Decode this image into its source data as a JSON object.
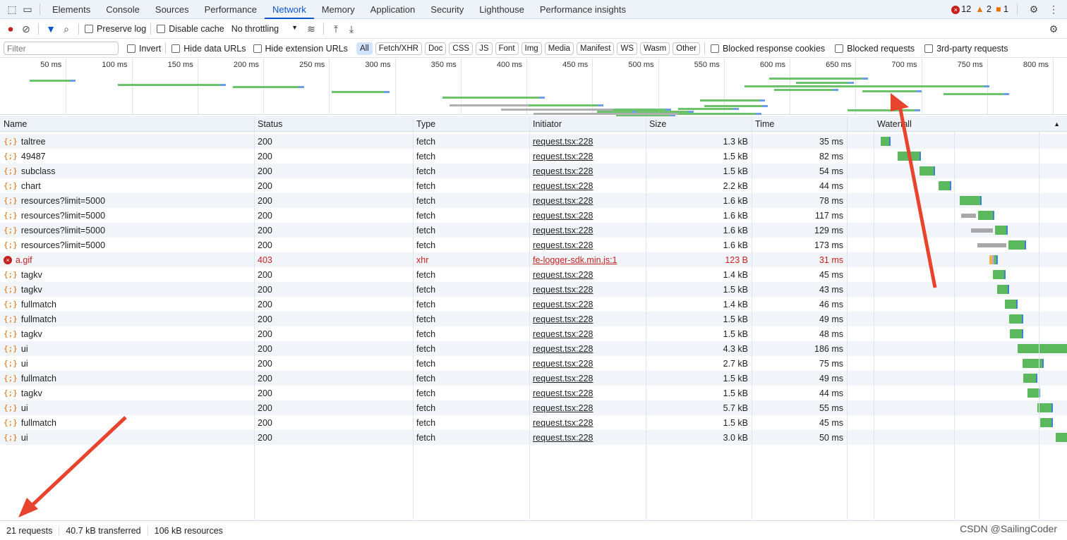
{
  "tabs": [
    "Elements",
    "Console",
    "Sources",
    "Performance",
    "Network",
    "Memory",
    "Application",
    "Security",
    "Lighthouse",
    "Performance insights"
  ],
  "active_tab": "Network",
  "badges": {
    "errors": "12",
    "warnings": "2",
    "issues": "1"
  },
  "toolbar": {
    "preserve_log": "Preserve log",
    "disable_cache": "Disable cache",
    "throttling": "No throttling"
  },
  "filterbar": {
    "placeholder": "Filter",
    "invert": "Invert",
    "hide_data": "Hide data URLs",
    "hide_ext": "Hide extension URLs",
    "types": [
      "All",
      "Fetch/XHR",
      "Doc",
      "CSS",
      "JS",
      "Font",
      "Img",
      "Media",
      "Manifest",
      "WS",
      "Wasm",
      "Other"
    ],
    "blocked_cookies": "Blocked response cookies",
    "blocked_requests": "Blocked requests",
    "third_party": "3rd-party requests"
  },
  "overview_ticks": [
    "50 ms",
    "100 ms",
    "150 ms",
    "200 ms",
    "250 ms",
    "300 ms",
    "350 ms",
    "400 ms",
    "450 ms",
    "500 ms",
    "550 ms",
    "600 ms",
    "650 ms",
    "700 ms",
    "750 ms",
    "800 ms"
  ],
  "columns": {
    "name": "Name",
    "status": "Status",
    "type": "Type",
    "initiator": "Initiator",
    "size": "Size",
    "time": "Time",
    "waterfall": "Waterfall"
  },
  "rows": [
    {
      "name": "taltree",
      "status": "200",
      "type": "fetch",
      "initiator": "request.tsx:228",
      "size": "1.3 kB",
      "time": "35 ms",
      "start": 20,
      "wait": 0,
      "dur": 35
    },
    {
      "name": "49487",
      "status": "200",
      "type": "fetch",
      "initiator": "request.tsx:228",
      "size": "1.5 kB",
      "time": "82 ms",
      "start": 80,
      "wait": 0,
      "dur": 82
    },
    {
      "name": "subclass",
      "status": "200",
      "type": "fetch",
      "initiator": "request.tsx:228",
      "size": "1.5 kB",
      "time": "54 ms",
      "start": 158,
      "wait": 0,
      "dur": 54
    },
    {
      "name": "chart",
      "status": "200",
      "type": "fetch",
      "initiator": "request.tsx:228",
      "size": "2.2 kB",
      "time": "44 ms",
      "start": 225,
      "wait": 0,
      "dur": 44
    },
    {
      "name": "resources?limit=5000",
      "status": "200",
      "type": "fetch",
      "initiator": "request.tsx:228",
      "size": "1.6 kB",
      "time": "78 ms",
      "start": 300,
      "wait": 0,
      "dur": 78
    },
    {
      "name": "resources?limit=5000",
      "status": "200",
      "type": "fetch",
      "initiator": "request.tsx:228",
      "size": "1.6 kB",
      "time": "117 ms",
      "start": 305,
      "wait": 60,
      "dur": 117
    },
    {
      "name": "resources?limit=5000",
      "status": "200",
      "type": "fetch",
      "initiator": "request.tsx:228",
      "size": "1.6 kB",
      "time": "129 ms",
      "start": 340,
      "wait": 85,
      "dur": 129
    },
    {
      "name": "resources?limit=5000",
      "status": "200",
      "type": "fetch",
      "initiator": "request.tsx:228",
      "size": "1.6 kB",
      "time": "173 ms",
      "start": 362,
      "wait": 110,
      "dur": 173
    },
    {
      "name": "a.gif",
      "status": "403",
      "type": "xhr",
      "initiator": "fe-logger-sdk.min.js:1",
      "size": "123 B",
      "time": "31 ms",
      "start": 405,
      "wait": 0,
      "dur": 31,
      "error": true
    },
    {
      "name": "tagkv",
      "status": "200",
      "type": "fetch",
      "initiator": "request.tsx:228",
      "size": "1.4 kB",
      "time": "45 ms",
      "start": 418,
      "wait": 0,
      "dur": 45
    },
    {
      "name": "tagkv",
      "status": "200",
      "type": "fetch",
      "initiator": "request.tsx:228",
      "size": "1.5 kB",
      "time": "43 ms",
      "start": 432,
      "wait": 0,
      "dur": 43
    },
    {
      "name": "fullmatch",
      "status": "200",
      "type": "fetch",
      "initiator": "request.tsx:228",
      "size": "1.4 kB",
      "time": "46 ms",
      "start": 460,
      "wait": 0,
      "dur": 46
    },
    {
      "name": "fullmatch",
      "status": "200",
      "type": "fetch",
      "initiator": "request.tsx:228",
      "size": "1.5 kB",
      "time": "49 ms",
      "start": 475,
      "wait": 0,
      "dur": 49
    },
    {
      "name": "tagkv",
      "status": "200",
      "type": "fetch",
      "initiator": "request.tsx:228",
      "size": "1.5 kB",
      "time": "48 ms",
      "start": 478,
      "wait": 0,
      "dur": 48
    },
    {
      "name": "ui",
      "status": "200",
      "type": "fetch",
      "initiator": "request.tsx:228",
      "size": "4.3 kB",
      "time": "186 ms",
      "start": 505,
      "wait": 0,
      "dur": 186
    },
    {
      "name": "ui",
      "status": "200",
      "type": "fetch",
      "initiator": "request.tsx:228",
      "size": "2.7 kB",
      "time": "75 ms",
      "start": 522,
      "wait": 0,
      "dur": 75
    },
    {
      "name": "fullmatch",
      "status": "200",
      "type": "fetch",
      "initiator": "request.tsx:228",
      "size": "1.5 kB",
      "time": "49 ms",
      "start": 525,
      "wait": 0,
      "dur": 49
    },
    {
      "name": "tagkv",
      "status": "200",
      "type": "fetch",
      "initiator": "request.tsx:228",
      "size": "1.5 kB",
      "time": "44 ms",
      "start": 540,
      "wait": 0,
      "dur": 44
    },
    {
      "name": "ui",
      "status": "200",
      "type": "fetch",
      "initiator": "request.tsx:228",
      "size": "5.7 kB",
      "time": "55 ms",
      "start": 575,
      "wait": 0,
      "dur": 55
    },
    {
      "name": "fullmatch",
      "status": "200",
      "type": "fetch",
      "initiator": "request.tsx:228",
      "size": "1.5 kB",
      "time": "45 ms",
      "start": 585,
      "wait": 0,
      "dur": 45
    },
    {
      "name": "ui",
      "status": "200",
      "type": "fetch",
      "initiator": "request.tsx:228",
      "size": "3.0 kB",
      "time": "50 ms",
      "start": 640,
      "wait": 0,
      "dur": 50
    }
  ],
  "footer": {
    "requests": "21 requests",
    "transferred": "40.7 kB transferred",
    "resources": "106 kB resources"
  },
  "watermark": "CSDN @SailingCoder",
  "colors": {
    "accent": "#0b57d0",
    "download": "#5cb85c",
    "waiting": "#a8a8a8",
    "error": "#c5221f",
    "annotation_arrow": "#e8432c"
  }
}
